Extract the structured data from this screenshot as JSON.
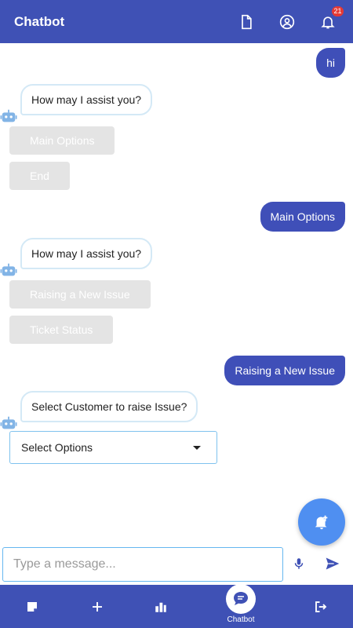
{
  "appbar": {
    "title": "Chatbot",
    "icons": [
      "document-icon",
      "account-icon",
      "bell-icon"
    ],
    "notification_count": "21"
  },
  "conversation": {
    "user_1": "hi",
    "bot_1": "How may I assist you?",
    "options_1": [
      "Main Options",
      "End"
    ],
    "user_2": "Main Options",
    "bot_2": "How may I assist you?",
    "options_2": [
      "Raising a New Issue",
      "Ticket Status"
    ],
    "user_3": "Raising a New Issue",
    "bot_3": "Select Customer to raise Issue?",
    "select_value": "Select Options"
  },
  "composer": {
    "placeholder": "Type a message..."
  },
  "bottom_nav": {
    "active_label": "Chatbot",
    "items": [
      "note-icon",
      "add-icon",
      "bar-chart-icon",
      "chatbot-icon",
      "logout-icon"
    ]
  },
  "colors": {
    "primary": "#3f51b5",
    "user_bubble": "#3f4fb8",
    "fab": "#4f8ff1",
    "option_disabled": "#e4e4e4",
    "badge": "#e53935"
  }
}
